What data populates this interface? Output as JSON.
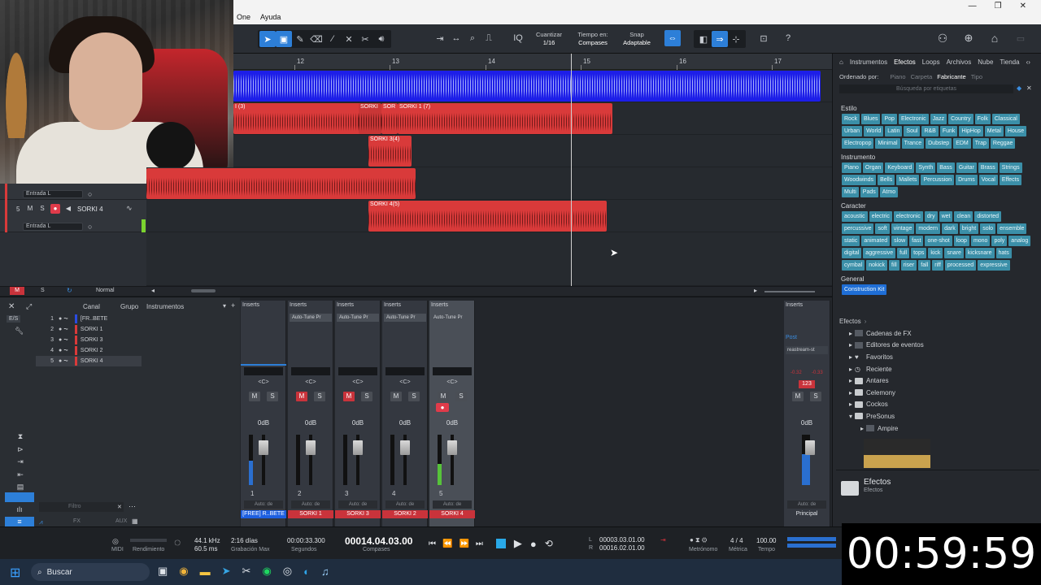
{
  "menu": [
    "One",
    "Ayuda"
  ],
  "toolbar": {
    "quantize": {
      "label": "Cuantizar",
      "value": "1/16"
    },
    "timebase": {
      "label": "Tiempo en:",
      "value": "Compases"
    },
    "snap": {
      "label": "Snap",
      "value": "Adaptable"
    },
    "iq": "IQ"
  },
  "ruler": [
    "12",
    "13",
    "14",
    "15",
    "16",
    "17"
  ],
  "clips": [
    {
      "label": "",
      "color": "#1d1ee8"
    },
    {
      "label": "I (3)",
      "color": "#d93a3a"
    },
    {
      "label": "SORKI",
      "color": "#d93a3a"
    },
    {
      "label": "SOR",
      "color": "#d93a3a"
    },
    {
      "label": "SORKI 1 (7)",
      "color": "#d93a3a"
    },
    {
      "label": "SORKI 3(4)",
      "color": "#d93a3a"
    },
    {
      "label": "",
      "color": "#d93a3a"
    },
    {
      "label": "SORKI 4(5)",
      "color": "#d93a3a"
    }
  ],
  "tracks": {
    "input_label": "Entrada L",
    "track5": {
      "num": "5",
      "m": "M",
      "s": "S",
      "name": "SORKI 4"
    }
  },
  "arrbar": {
    "m": "M",
    "s": "S",
    "mode": "Normal"
  },
  "browser": {
    "tabs": [
      "Instrumentos",
      "Efectos",
      "Loops",
      "Archivos",
      "Nube",
      "Tienda"
    ],
    "sort_label": "Ordenado por:",
    "sort_opts": [
      "Piano",
      "Carpeta",
      "Fabricante",
      "Tipo"
    ],
    "search_placeholder": "Búsqueda por etiquetas",
    "sections": [
      {
        "title": "Estilo",
        "tags": [
          "Rock",
          "Blues",
          "Pop",
          "Electronic",
          "Jazz",
          "Country",
          "Folk",
          "Classical",
          "Urban",
          "World",
          "Latin",
          "Soul",
          "R&B",
          "Funk",
          "HipHop",
          "Metal",
          "House",
          "Electropop",
          "Minimal",
          "Trance",
          "Dubstep",
          "EDM",
          "Trap",
          "Reggae"
        ]
      },
      {
        "title": "Instrumento",
        "tags": [
          "Piano",
          "Organ",
          "Keyboard",
          "Synth",
          "Bass",
          "Guitar",
          "Brass",
          "Strings",
          "Woodwinds",
          "Bells",
          "Mallets",
          "Percussion",
          "Drums",
          "Vocal",
          "Effects",
          "Multi",
          "Pads",
          "Atmo"
        ]
      },
      {
        "title": "Caracter",
        "tags": [
          "acoustic",
          "electric",
          "electronic",
          "dry",
          "wet",
          "clean",
          "distorted",
          "percussive",
          "soft",
          "vintage",
          "modern",
          "dark",
          "bright",
          "solo",
          "ensemble",
          "static",
          "animated",
          "slow",
          "fast",
          "one-shot",
          "loop",
          "mono",
          "poly",
          "analog",
          "digital",
          "aggressive",
          "full",
          "tops",
          "kick",
          "snare",
          "kicksnare",
          "hats",
          "cymbal",
          "nokick",
          "fill",
          "riser",
          "fall",
          "riff",
          "processed",
          "expressive"
        ]
      },
      {
        "title": "General",
        "tags": [
          "Construction Kit"
        ]
      }
    ],
    "crumb": "Efectos",
    "tree": [
      "Cadenas de FX",
      "Editores de eventos",
      "Favoritos",
      "Reciente",
      "Antares",
      "Celemony",
      "Cockos",
      "PreSonus",
      "Ampire"
    ],
    "footer_title": "Efectos",
    "footer_sub": "Efectos"
  },
  "mixlist": {
    "headers": [
      "Canal",
      "Grupo",
      "Instrumentos"
    ],
    "es": "E/S",
    "channels": [
      {
        "num": "1",
        "name": "[FR..BETE"
      },
      {
        "num": "2",
        "name": "SORKI 1"
      },
      {
        "num": "3",
        "name": "SORKI 3"
      },
      {
        "num": "4",
        "name": "SORKI 2"
      },
      {
        "num": "5",
        "name": "SORKI 4"
      }
    ],
    "filter": "Filtro"
  },
  "strips": [
    {
      "num": "1",
      "name": "[FREE] R..BETE",
      "plug": "",
      "vol": "0dB",
      "name_color": "#1d5fe0"
    },
    {
      "num": "2",
      "name": "SORKI 1",
      "plug": "Auto-Tune Pr",
      "vol": "0dB",
      "name_color": "#c9333b"
    },
    {
      "num": "3",
      "name": "SORKI 3",
      "plug": "Auto-Tune Pr",
      "vol": "0dB",
      "name_color": "#c9333b"
    },
    {
      "num": "4",
      "name": "SORKI 2",
      "plug": "Auto-Tune Pr",
      "vol": "0dB",
      "name_color": "#c9333b"
    },
    {
      "num": "5",
      "name": "SORKI 4",
      "plug": "Auto-Tune Pr",
      "vol": "0dB",
      "name_color": "#c9333b"
    }
  ],
  "strip_common": {
    "inserts": "Inserts",
    "pan": "<C>",
    "m": "M",
    "s": "S",
    "auto": "Auto: de"
  },
  "main_strip": {
    "inserts": "Inserts",
    "post": "Post",
    "plug": "reastream-st",
    "lvl_l": "-0.32",
    "lvl_r": "-0.33",
    "peak": "123",
    "vol": "0dB",
    "auto": "Auto: de",
    "name": "Principal",
    "m": "M",
    "s": "S"
  },
  "transport": {
    "midi": "MIDI",
    "perf": "Rendimiento",
    "rate": "44.1 kHz",
    "latency": "60.5 ms",
    "rec_days": "2:16 días",
    "rec_label": "Grabación Max",
    "seconds": "00:00:33.300",
    "seconds_label": "Segundos",
    "bars": "00014.04.03.00",
    "bars_label": "Compases",
    "loop_l": "00003.03.01.00",
    "loop_r": "00016.02.01.00",
    "l": "L",
    "r": "R",
    "metro_label": "Metrónomo",
    "sig": "4 / 4",
    "sig_label": "Métrica",
    "tempo": "100.00",
    "tempo_label": "Tempo"
  },
  "taskbar": {
    "search": "Buscar"
  },
  "timer": "00:59:59"
}
